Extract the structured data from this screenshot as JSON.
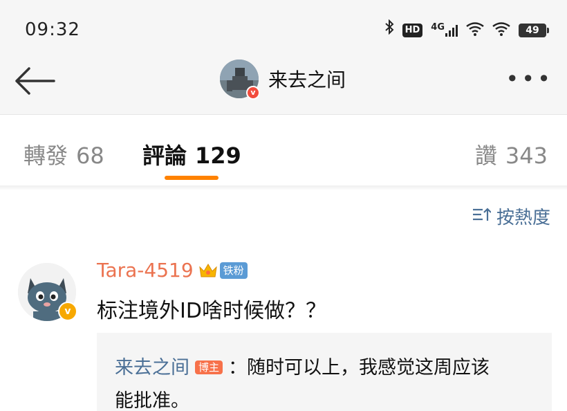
{
  "status_bar": {
    "time": "09:32",
    "bluetooth_icon": "bluetooth-icon",
    "hd_label": "HD",
    "network_label": "4G",
    "battery": "49"
  },
  "header": {
    "title": "来去之间",
    "back_icon": "arrow-left-icon",
    "more_icon": "more-dots-icon",
    "more_label": "•••"
  },
  "tabs": [
    {
      "label": "轉發",
      "count": "68"
    },
    {
      "label": "評論",
      "count": "129",
      "active": true
    },
    {
      "label": "讚",
      "count": "343"
    }
  ],
  "sort": {
    "label": "按熱度",
    "icon": "sort-icon",
    "icon_glyph": "三↑"
  },
  "comment": {
    "author": "Tara-4519",
    "fan_badge": "铁粉",
    "text": "标注境外ID啥时候做？？",
    "reply": {
      "author": "来去之间",
      "op_badge": "博主",
      "separator": "：",
      "line1": "随时可以上，我感觉这周应该",
      "line2": "能批准。"
    }
  },
  "colors": {
    "accent": "#ff8200",
    "username": "#eb7350",
    "link_blue": "#4a6f96",
    "verified_gold": "#f7a800",
    "op_badge": "#f7714a",
    "fan_badge": "#5b9bd5"
  }
}
